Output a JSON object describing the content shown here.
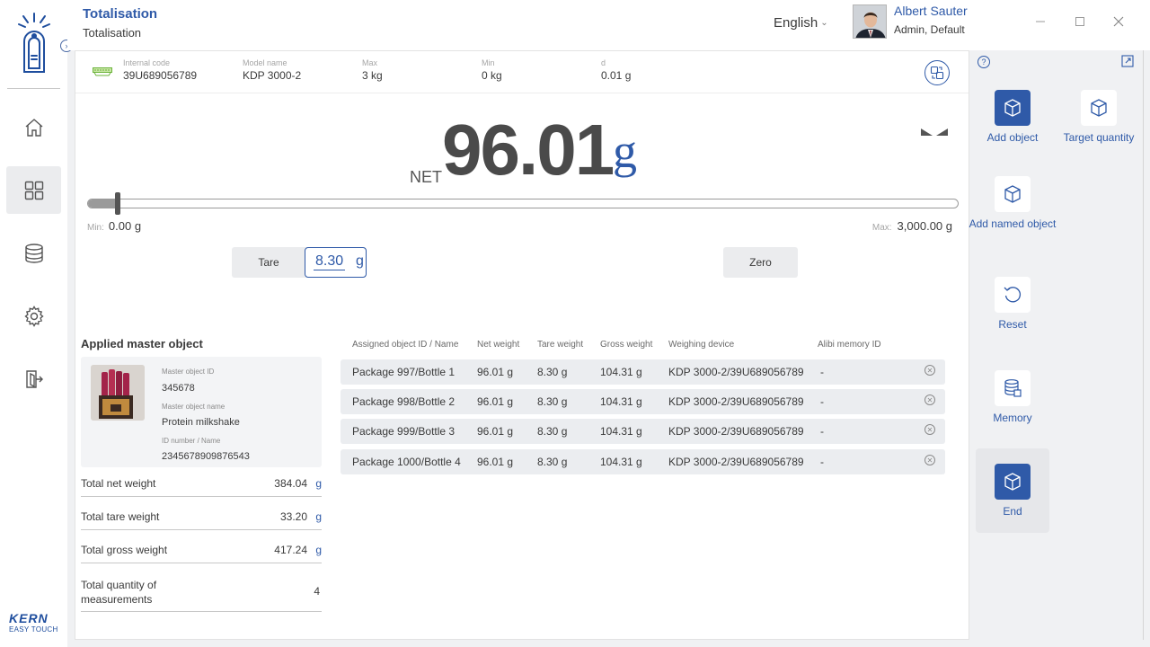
{
  "header": {
    "title": "Totalisation",
    "subtitle": "Totalisation",
    "language": "English",
    "user_name": "Albert Sauter",
    "user_role": "Admin, Default"
  },
  "sidebar": {
    "items": [
      {
        "name": "home",
        "icon": "home-icon"
      },
      {
        "name": "dashboard",
        "icon": "grid-icon",
        "active": true
      },
      {
        "name": "database",
        "icon": "database-icon"
      },
      {
        "name": "settings",
        "icon": "gear-icon"
      },
      {
        "name": "logout",
        "icon": "exit-icon"
      }
    ],
    "brand": "KERN",
    "brand_sub": "EASY TOUCH"
  },
  "info_bar": {
    "internal_code_label": "Internal code",
    "internal_code": "39U689056789",
    "model_label": "Model name",
    "model": "KDP 3000-2",
    "max_label": "Max",
    "max": "3 kg",
    "min_label": "Min",
    "min": "0 kg",
    "d_label": "d",
    "d": "0.01 g"
  },
  "display": {
    "net_label": "NET",
    "weight": "96.01",
    "unit": "g",
    "range_fraction": 0.032,
    "min_label": "Min:",
    "min_value": "0.00 g",
    "max_label": "Max:",
    "max_value": "3,000.00 g"
  },
  "controls": {
    "tare_label": "Tare",
    "tare_value": "8.30",
    "tare_unit": "g",
    "zero_label": "Zero"
  },
  "master": {
    "title": "Applied master object",
    "id_label": "Master object ID",
    "id": "345678",
    "name_label": "Master object name",
    "name": "Protein milkshake",
    "idnum_label": "ID number / Name",
    "idnum": "2345678909876543"
  },
  "totals": [
    {
      "label": "Total net weight",
      "value": "384.04",
      "unit": "g"
    },
    {
      "label": "Total tare weight",
      "value": "33.20",
      "unit": "g"
    },
    {
      "label": "Total gross weight",
      "value": "417.24",
      "unit": "g"
    },
    {
      "label": "Total quantity of measurements",
      "value": "4",
      "unit": ""
    }
  ],
  "table": {
    "headers": [
      "Assigned object ID / Name",
      "Net weight",
      "Tare weight",
      "Gross weight",
      "Weighing device",
      "Alibi memory ID"
    ],
    "rows": [
      [
        "Package 997/Bottle 1",
        "96.01 g",
        "8.30 g",
        "104.31 g",
        "KDP 3000-2/39U689056789",
        "-"
      ],
      [
        "Package 998/Bottle 2",
        "96.01 g",
        "8.30 g",
        "104.31 g",
        "KDP 3000-2/39U689056789",
        "-"
      ],
      [
        "Package 999/Bottle 3",
        "96.01 g",
        "8.30 g",
        "104.31 g",
        "KDP 3000-2/39U689056789",
        "-"
      ],
      [
        "Package 1000/Bottle 4",
        "96.01 g",
        "8.30 g",
        "104.31 g",
        "KDP 3000-2/39U689056789",
        "-"
      ]
    ]
  },
  "actions": {
    "add_object": "Add object",
    "target_quantity": "Target quantity",
    "add_named_object": "Add named object",
    "reset": "Reset",
    "memory": "Memory",
    "end": "End"
  },
  "colors": {
    "accent": "#2f5aa8",
    "text": "#3a3a3a",
    "panel": "#f0f1f3"
  }
}
